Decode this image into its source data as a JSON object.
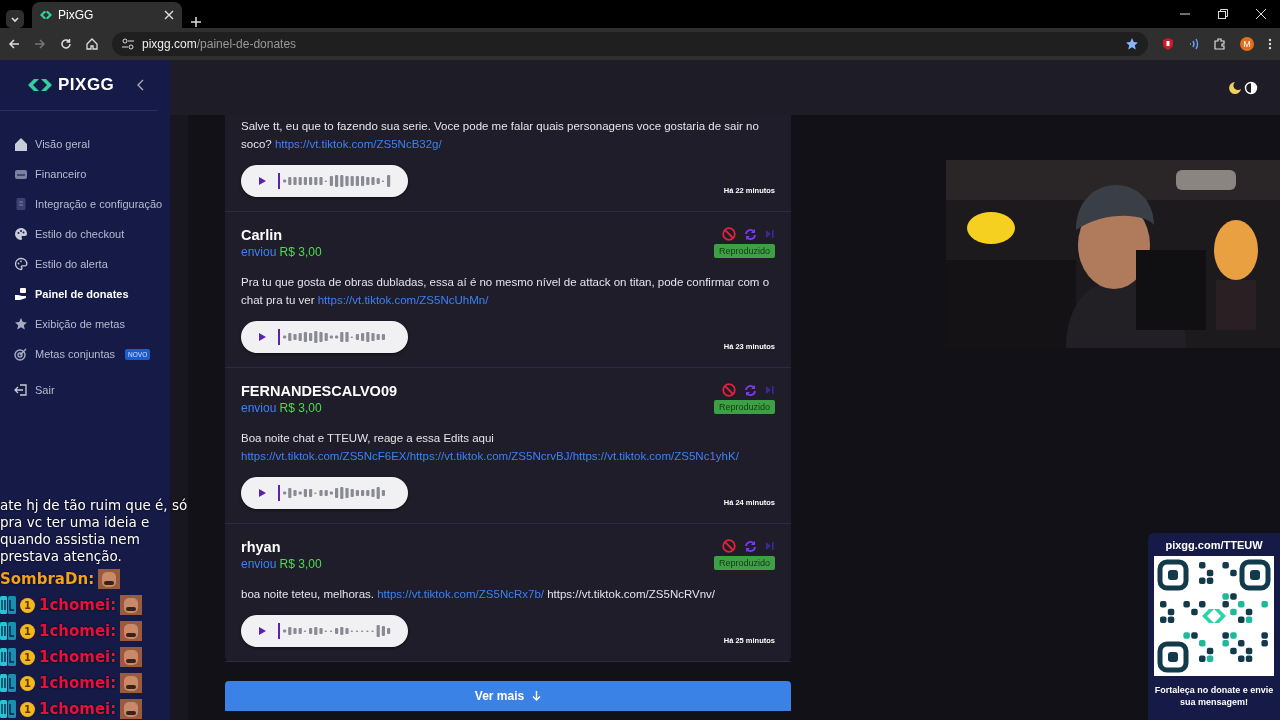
{
  "browser": {
    "tabs": [
      {
        "title": "PixGG",
        "selected": true
      }
    ],
    "url_host": "pixgg.com",
    "url_path": "/painel-de-donates",
    "profile_initial": "M"
  },
  "sidebar": {
    "logo": "PIXGG",
    "items": [
      {
        "label": "Visão geral",
        "selected": false
      },
      {
        "label": "Financeiro",
        "selected": false
      },
      {
        "label": "Integração e configuração",
        "selected": false
      },
      {
        "label": "Estilo do checkout",
        "selected": false
      },
      {
        "label": "Estilo do alerta",
        "selected": false
      },
      {
        "label": "Painel de donates",
        "selected": true
      },
      {
        "label": "Exibição de metas",
        "selected": false
      },
      {
        "label": "Metas conjuntas",
        "selected": false,
        "badge": "NOVO"
      },
      {
        "label": "Sair",
        "selected": false
      }
    ]
  },
  "donations": [
    {
      "message": [
        {
          "text": "Salve tt, eu que to fazendo sua serie. Voce pode me falar quais personagens voce gostaria de sair no soco? ",
          "link": false
        },
        {
          "text": "https://vt.tiktok.com/ZS5NcB32g/",
          "link": true
        }
      ],
      "time": "Há 22 minutos"
    },
    {
      "name": "Carlin",
      "sent_label": "enviou",
      "amount": "R$ 3,00",
      "status": "Reproduzido",
      "message": [
        {
          "text": "Pra tu que gosta de obras dubladas, essa aí é no mesmo nível de attack on titan, pode confirmar com o chat pra tu ver ",
          "link": false
        },
        {
          "text": "https://vt.tiktok.com/ZS5NcUhMn/",
          "link": true
        }
      ],
      "time": "Há 23 minutos"
    },
    {
      "name": "FERNANDESCALVO09",
      "sent_label": "enviou",
      "amount": "R$ 3,00",
      "status": "Reproduzido",
      "message": [
        {
          "text": "Boa noite chat e TTEUW, reage a essa Edits aqui ",
          "link": false
        },
        {
          "text": "https://vt.tiktok.com/ZS5NcF6EX/https://vt.tiktok.com/ZS5NcrvBJ/https://vt.tiktok.com/ZS5Nc1yhK/",
          "link": true
        }
      ],
      "time": "Há 24 minutos"
    },
    {
      "name": "rhyan",
      "sent_label": "enviou",
      "amount": "R$ 3,00",
      "status": "Reproduzido",
      "message": [
        {
          "text": "boa noite teteu, melhoras. ",
          "link": false
        },
        {
          "text": "https://vt.tiktok.com/ZS5NcRx7b/",
          "link": true
        },
        {
          "text": " https://vt.tiktok.com/ZS5NcRVnv/",
          "link": false
        }
      ],
      "time": "Há 25 minutos"
    }
  ],
  "more_button": "Ver mais",
  "chat": {
    "messages": [
      {
        "kind": "text",
        "text": "ate hj de tão ruim que é, só pra vc ter uma ideia e quando assistia nem prestava atenção."
      },
      {
        "kind": "emote",
        "user": "SombraDn:",
        "color": "#f2a21c"
      },
      {
        "kind": "emote",
        "user": "1chomei:",
        "color": "#e8103c",
        "coin": "1"
      },
      {
        "kind": "emote",
        "user": "1chomei:",
        "color": "#e8103c",
        "coin": "1"
      },
      {
        "kind": "emote",
        "user": "1chomei:",
        "color": "#e8103c",
        "coin": "1"
      },
      {
        "kind": "emote",
        "user": "1chomei:",
        "color": "#e8103c",
        "coin": "1"
      },
      {
        "kind": "emote",
        "user": "1chomei:",
        "color": "#e8103c",
        "coin": "1"
      }
    ]
  },
  "qr_card": {
    "url": "pixgg.com/TTEUW",
    "caption": "Fortaleça no donate e envie sua mensagem!"
  }
}
